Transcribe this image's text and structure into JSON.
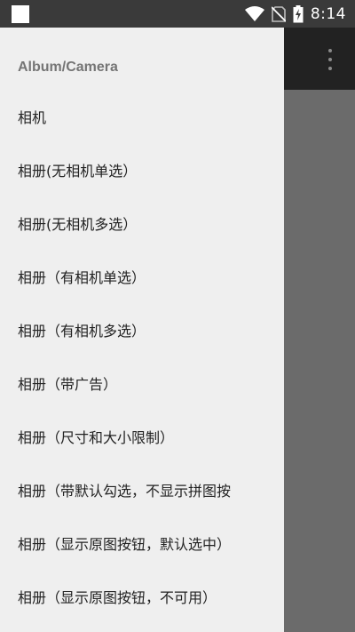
{
  "status_bar": {
    "time": "8:14",
    "icons": [
      "notification-square-icon",
      "wifi-icon",
      "no-sim-icon",
      "battery-charging-icon"
    ]
  },
  "toolbar": {
    "overflow_icon": "more-vertical-icon"
  },
  "drawer": {
    "header": "Album/Camera",
    "items": [
      {
        "label": "相机"
      },
      {
        "label": "相册(无相机单选）"
      },
      {
        "label": "相册(无相机多选）"
      },
      {
        "label": "相册（有相机单选）"
      },
      {
        "label": "相册（有相机多选）"
      },
      {
        "label": "相册（带广告）"
      },
      {
        "label": "相册（尺寸和大小限制）"
      },
      {
        "label": "相册（带默认勾选，不显示拼图按"
      },
      {
        "label": "相册（显示原图按钮，默认选中）"
      },
      {
        "label": "相册（显示原图按钮，不可用）"
      }
    ]
  },
  "colors": {
    "status_bar": "#3a3a3a",
    "toolbar": "#222222",
    "drawer_bg": "#efefef",
    "scrim": "#6b6b6b",
    "header_text": "#757575",
    "item_text": "#222222"
  }
}
